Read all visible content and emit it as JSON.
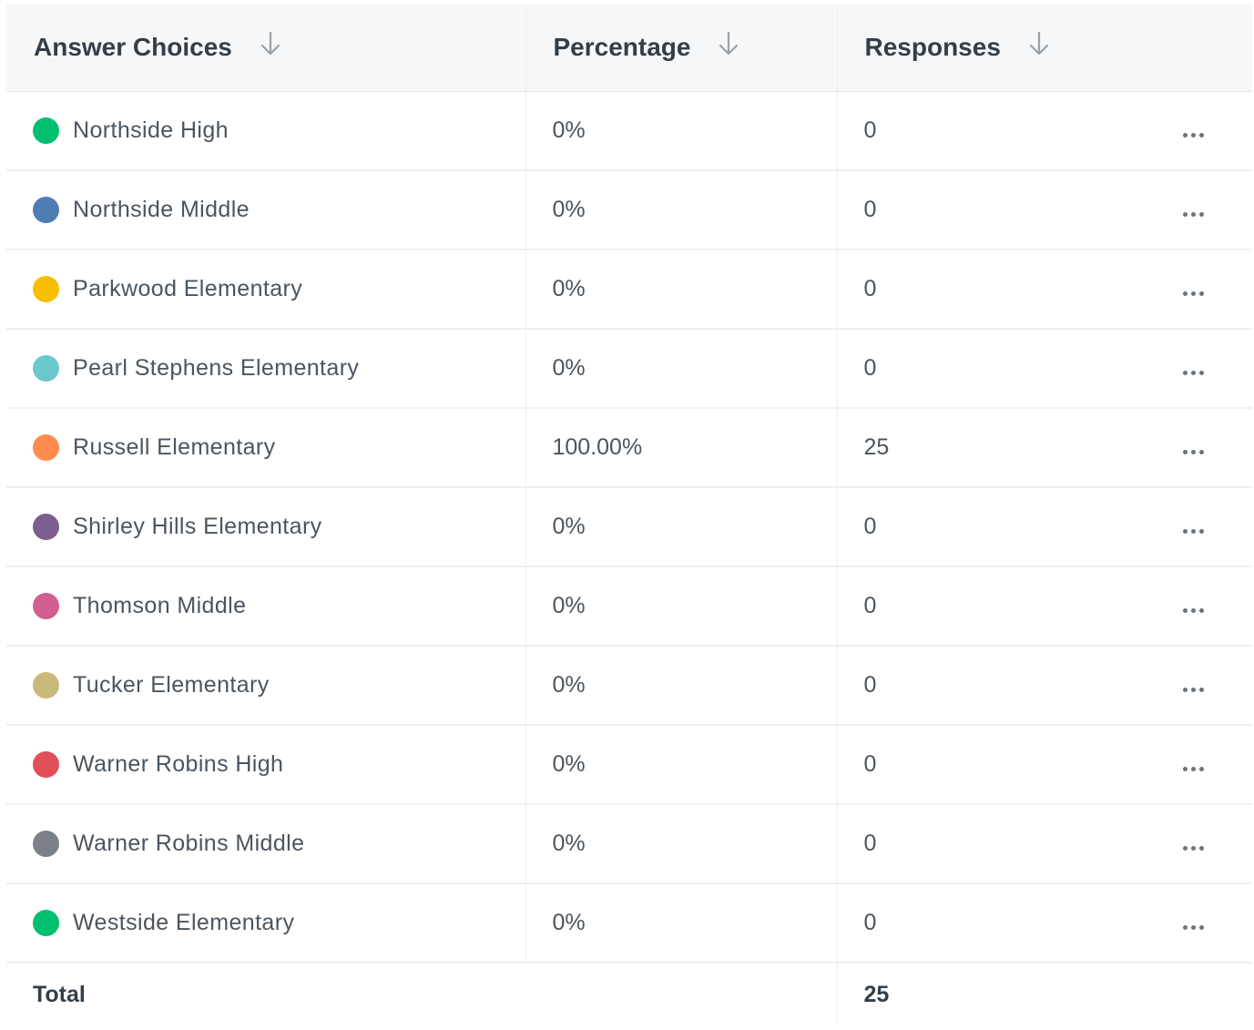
{
  "table": {
    "headers": {
      "answer_choices": "Answer Choices",
      "percentage": "Percentage",
      "responses": "Responses"
    },
    "rows": [
      {
        "label": "Northside High",
        "percentage": "0%",
        "responses": "0",
        "color": "#00bf6f"
      },
      {
        "label": "Northside Middle",
        "percentage": "0%",
        "responses": "0",
        "color": "#507cb6"
      },
      {
        "label": "Parkwood Elementary",
        "percentage": "0%",
        "responses": "0",
        "color": "#f9be00"
      },
      {
        "label": "Pearl Stephens Elementary",
        "percentage": "0%",
        "responses": "0",
        "color": "#6bc8cd"
      },
      {
        "label": "Russell Elementary",
        "percentage": "100.00%",
        "responses": "25",
        "color": "#ff8b4f"
      },
      {
        "label": "Shirley Hills Elementary",
        "percentage": "0%",
        "responses": "0",
        "color": "#7d5e90"
      },
      {
        "label": "Thomson Middle",
        "percentage": "0%",
        "responses": "0",
        "color": "#d25f90"
      },
      {
        "label": "Tucker Elementary",
        "percentage": "0%",
        "responses": "0",
        "color": "#c9b97a"
      },
      {
        "label": "Warner Robins High",
        "percentage": "0%",
        "responses": "0",
        "color": "#e05058"
      },
      {
        "label": "Warner Robins Middle",
        "percentage": "0%",
        "responses": "0",
        "color": "#7b8187"
      },
      {
        "label": "Westside Elementary",
        "percentage": "0%",
        "responses": "0",
        "color": "#00bf6f"
      }
    ],
    "total": {
      "label": "Total",
      "responses": "25"
    }
  }
}
